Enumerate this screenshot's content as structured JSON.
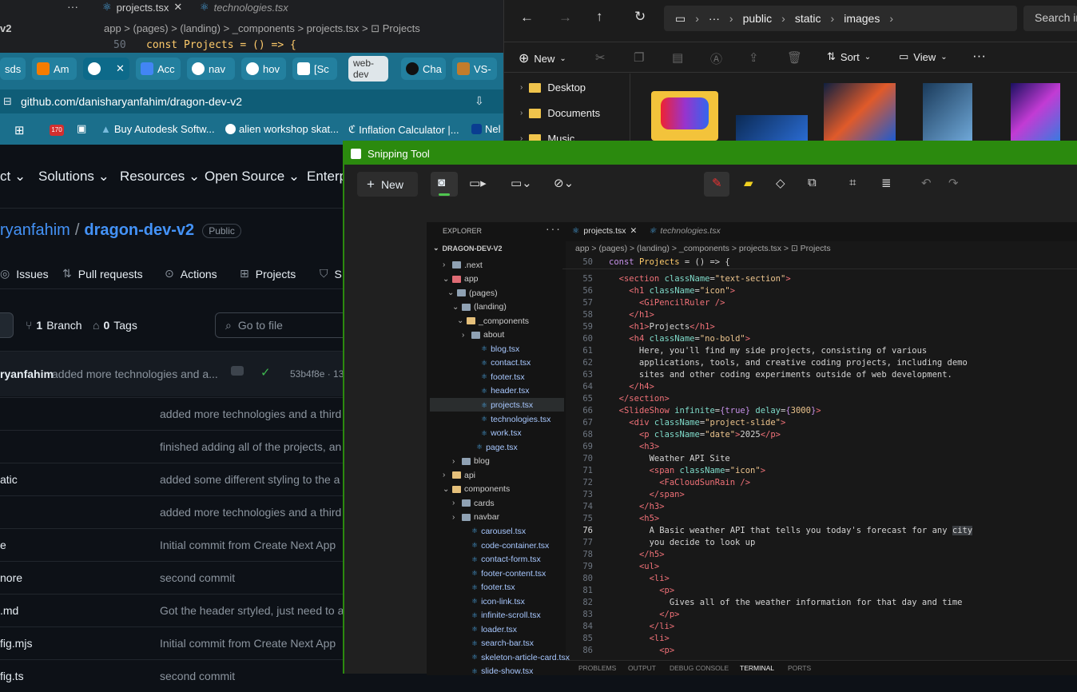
{
  "vscode_top": {
    "tab1": "projects.tsx",
    "tab2": "technologies.tsx",
    "left_label": "v2",
    "breadcrumb": "app > (pages) > (landing) > _components > projects.tsx > ⊡ Projects",
    "line_no": "50",
    "code": "const Projects = () => {"
  },
  "chrome": {
    "tabs": [
      "sds",
      "Am",
      "",
      "Acc",
      "nav",
      "hov",
      "[Sc",
      "web-dev",
      "Cha",
      "VS-"
    ],
    "url": "github.com/danisharyanfahim/dragon-dev-v2",
    "bookmarks": [
      "Buy Autodesk Softw...",
      "alien workshop skat...",
      "Inflation Calculator |...",
      "Nel"
    ],
    "badge": "170"
  },
  "github": {
    "nav": [
      "ct",
      "Solutions",
      "Resources",
      "Open Source",
      "Enterp"
    ],
    "owner": "ryanfahim",
    "sep": "/",
    "repo": "dragon-dev-v2",
    "visibility": "Public",
    "tabs": [
      "Issues",
      "Pull requests",
      "Actions",
      "Projects",
      "S"
    ],
    "branch_count": "1",
    "branch_label": "Branch",
    "tag_count": "0",
    "tag_label": "Tags",
    "goto_file": "Go to file",
    "commit_author": "ryanfahim",
    "commit_msg": "added more technologies and a...",
    "commit_hash": "53b4f8e · 13",
    "files": [
      {
        "name": "",
        "msg": "added more technologies and a third"
      },
      {
        "name": "",
        "msg": "finished adding all of the projects, an"
      },
      {
        "name": "atic",
        "msg": "added some different styling to the a"
      },
      {
        "name": "",
        "msg": "added more technologies and a third"
      },
      {
        "name": "e",
        "msg": "Initial commit from Create Next App"
      },
      {
        "name": "nore",
        "msg": "second commit"
      },
      {
        "name": ".md",
        "msg": "Got the header srtyled, just need to a"
      },
      {
        "name": "fig.mjs",
        "msg": "Initial commit from Create Next App"
      },
      {
        "name": "fig.ts",
        "msg": "second commit"
      }
    ]
  },
  "explorer": {
    "path": [
      "public",
      "static",
      "images"
    ],
    "search": "Search im",
    "new": "New",
    "sort": "Sort",
    "view": "View",
    "tree": [
      "Desktop",
      "Documents",
      "Music"
    ]
  },
  "snip": {
    "title": "Snipping Tool",
    "new": "New"
  },
  "inner": {
    "explorer_title": "EXPLORER",
    "root": "DRAGON-DEV-V2",
    "tab1": "projects.tsx",
    "tab2": "technologies.tsx",
    "breadcrumb": "app > (pages) > (landing) > _components > projects.tsx > ⊡ Projects",
    "tree": [
      ".next",
      "app",
      "(pages)",
      "(landing)",
      "_components",
      "about",
      "blog.tsx",
      "contact.tsx",
      "footer.tsx",
      "header.tsx",
      "projects.tsx",
      "technologies.tsx",
      "work.tsx",
      "page.tsx",
      "blog",
      "api",
      "components",
      "cards",
      "navbar",
      "carousel.tsx",
      "code-container.tsx",
      "contact-form.tsx",
      "footer-content.tsx",
      "footer.tsx",
      "icon-link.tsx",
      "infinite-scroll.tsx",
      "loader.tsx",
      "search-bar.tsx",
      "skeleton-article-card.tsx",
      "slide-show.tsx"
    ],
    "line_numbers": [
      "50",
      "55",
      "56",
      "57",
      "58",
      "59",
      "60",
      "61",
      "62",
      "63",
      "64",
      "65",
      "66",
      "67",
      "68",
      "69",
      "70",
      "71",
      "72",
      "73",
      "74",
      "75",
      "76",
      "77",
      "78",
      "79",
      "80",
      "81",
      "82",
      "83",
      "84",
      "85",
      "86"
    ],
    "panel": [
      "PROBLEMS",
      "OUTPUT",
      "DEBUG CONSOLE",
      "TERMINAL",
      "PORTS"
    ]
  }
}
